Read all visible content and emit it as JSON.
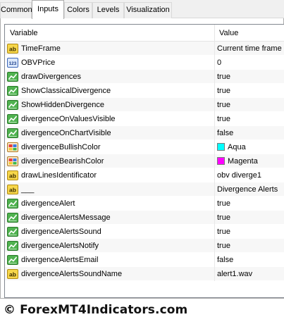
{
  "tabs": [
    "Common",
    "Inputs",
    "Colors",
    "Levels",
    "Visualization"
  ],
  "active_tab": "Inputs",
  "table": {
    "headers": {
      "variable": "Variable",
      "value": "Value"
    },
    "rows": [
      {
        "type": "string",
        "icon": "ab-icon",
        "name": "TimeFrame",
        "value": "Current time frame"
      },
      {
        "type": "integer",
        "icon": "integer-123-icon",
        "name": "OBVPrice",
        "value": "0"
      },
      {
        "type": "bool",
        "icon": "bool-chart-icon",
        "name": "drawDivergences",
        "value": "true"
      },
      {
        "type": "bool",
        "icon": "bool-chart-icon",
        "name": "ShowClassicalDivergence",
        "value": "true"
      },
      {
        "type": "bool",
        "icon": "bool-chart-icon",
        "name": "ShowHiddenDivergence",
        "value": "true"
      },
      {
        "type": "bool",
        "icon": "bool-chart-icon",
        "name": "divergenceOnValuesVisible",
        "value": "true"
      },
      {
        "type": "bool",
        "icon": "bool-chart-icon",
        "name": "divergenceOnChartVisible",
        "value": "false"
      },
      {
        "type": "color",
        "icon": "color-palette-icon",
        "name": "divergenceBullishColor",
        "value": "Aqua",
        "color": "#00ffff"
      },
      {
        "type": "color",
        "icon": "color-palette-icon",
        "name": "divergenceBearishColor",
        "value": "Magenta",
        "color": "#ff00ff"
      },
      {
        "type": "string",
        "icon": "ab-icon",
        "name": "drawLinesIdentificator",
        "value": "obv diverge1"
      },
      {
        "type": "string",
        "icon": "ab-icon",
        "name": "___",
        "value": "Divergence Alerts"
      },
      {
        "type": "bool",
        "icon": "bool-chart-icon",
        "name": "divergenceAlert",
        "value": "true"
      },
      {
        "type": "bool",
        "icon": "bool-chart-icon",
        "name": "divergenceAlertsMessage",
        "value": "true"
      },
      {
        "type": "bool",
        "icon": "bool-chart-icon",
        "name": "divergenceAlertsSound",
        "value": "true"
      },
      {
        "type": "bool",
        "icon": "bool-chart-icon",
        "name": "divergenceAlertsNotify",
        "value": "true"
      },
      {
        "type": "bool",
        "icon": "bool-chart-icon",
        "name": "divergenceAlertsEmail",
        "value": "false"
      },
      {
        "type": "string",
        "icon": "ab-icon",
        "name": "divergenceAlertsSoundName",
        "value": "alert1.wav"
      }
    ]
  },
  "watermark": "© ForexMT4Indicators.com"
}
